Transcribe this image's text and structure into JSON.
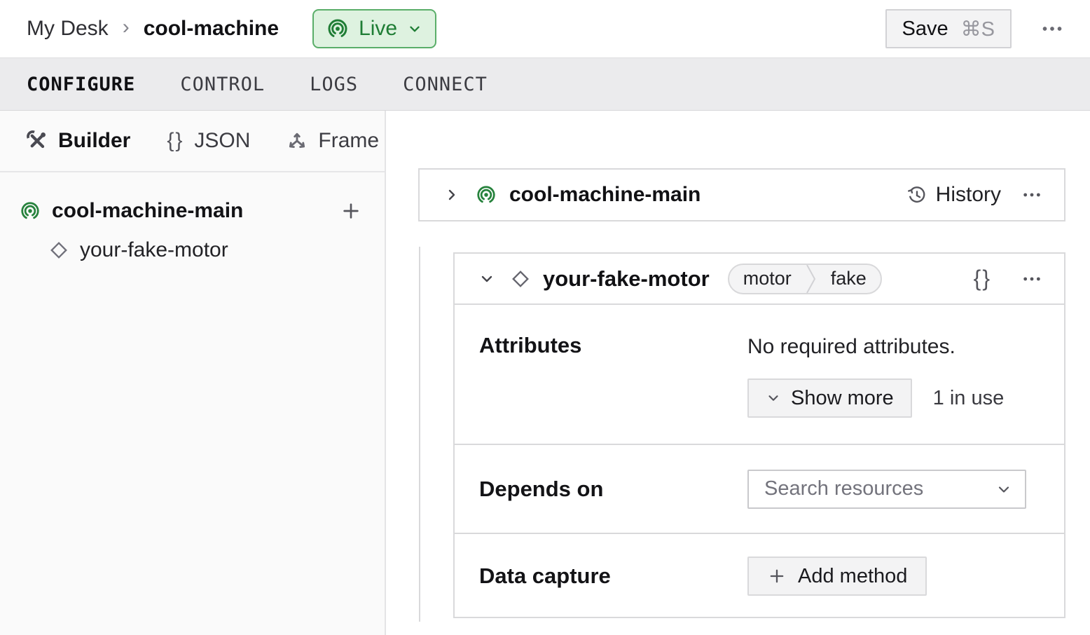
{
  "header": {
    "breadcrumb": {
      "root": "My Desk",
      "separator": "›",
      "machine": "cool-machine"
    },
    "live_button": {
      "label": "Live"
    },
    "save_button": {
      "label": "Save",
      "shortcut": "⌘S"
    }
  },
  "tabs": [
    {
      "label": "CONFIGURE"
    },
    {
      "label": "CONTROL"
    },
    {
      "label": "LOGS"
    },
    {
      "label": "CONNECT"
    }
  ],
  "sidebar": {
    "modes": [
      {
        "label": "Builder"
      },
      {
        "label": "JSON"
      },
      {
        "label": "Frame"
      }
    ],
    "tree": {
      "root_label": "cool-machine-main",
      "child_label": "your-fake-motor"
    }
  },
  "main": {
    "part_card": {
      "title": "cool-machine-main",
      "history_label": "History"
    },
    "resource_card": {
      "title": "your-fake-motor",
      "badge": {
        "type": "motor",
        "model": "fake"
      },
      "attributes": {
        "label": "Attributes",
        "empty_text": "No required attributes.",
        "show_more_label": "Show more",
        "usage_text": "1 in use"
      },
      "depends_on": {
        "label": "Depends on",
        "placeholder": "Search resources"
      },
      "data_capture": {
        "label": "Data capture",
        "add_button_label": "Add method"
      }
    }
  },
  "icons": {
    "braces": "{}"
  },
  "colors": {
    "accent_green": "#1f7d35",
    "live_bg": "#def2e0",
    "live_border": "#5aae69",
    "tabbar_bg": "#ebebed",
    "card_border": "#d9d9db"
  }
}
